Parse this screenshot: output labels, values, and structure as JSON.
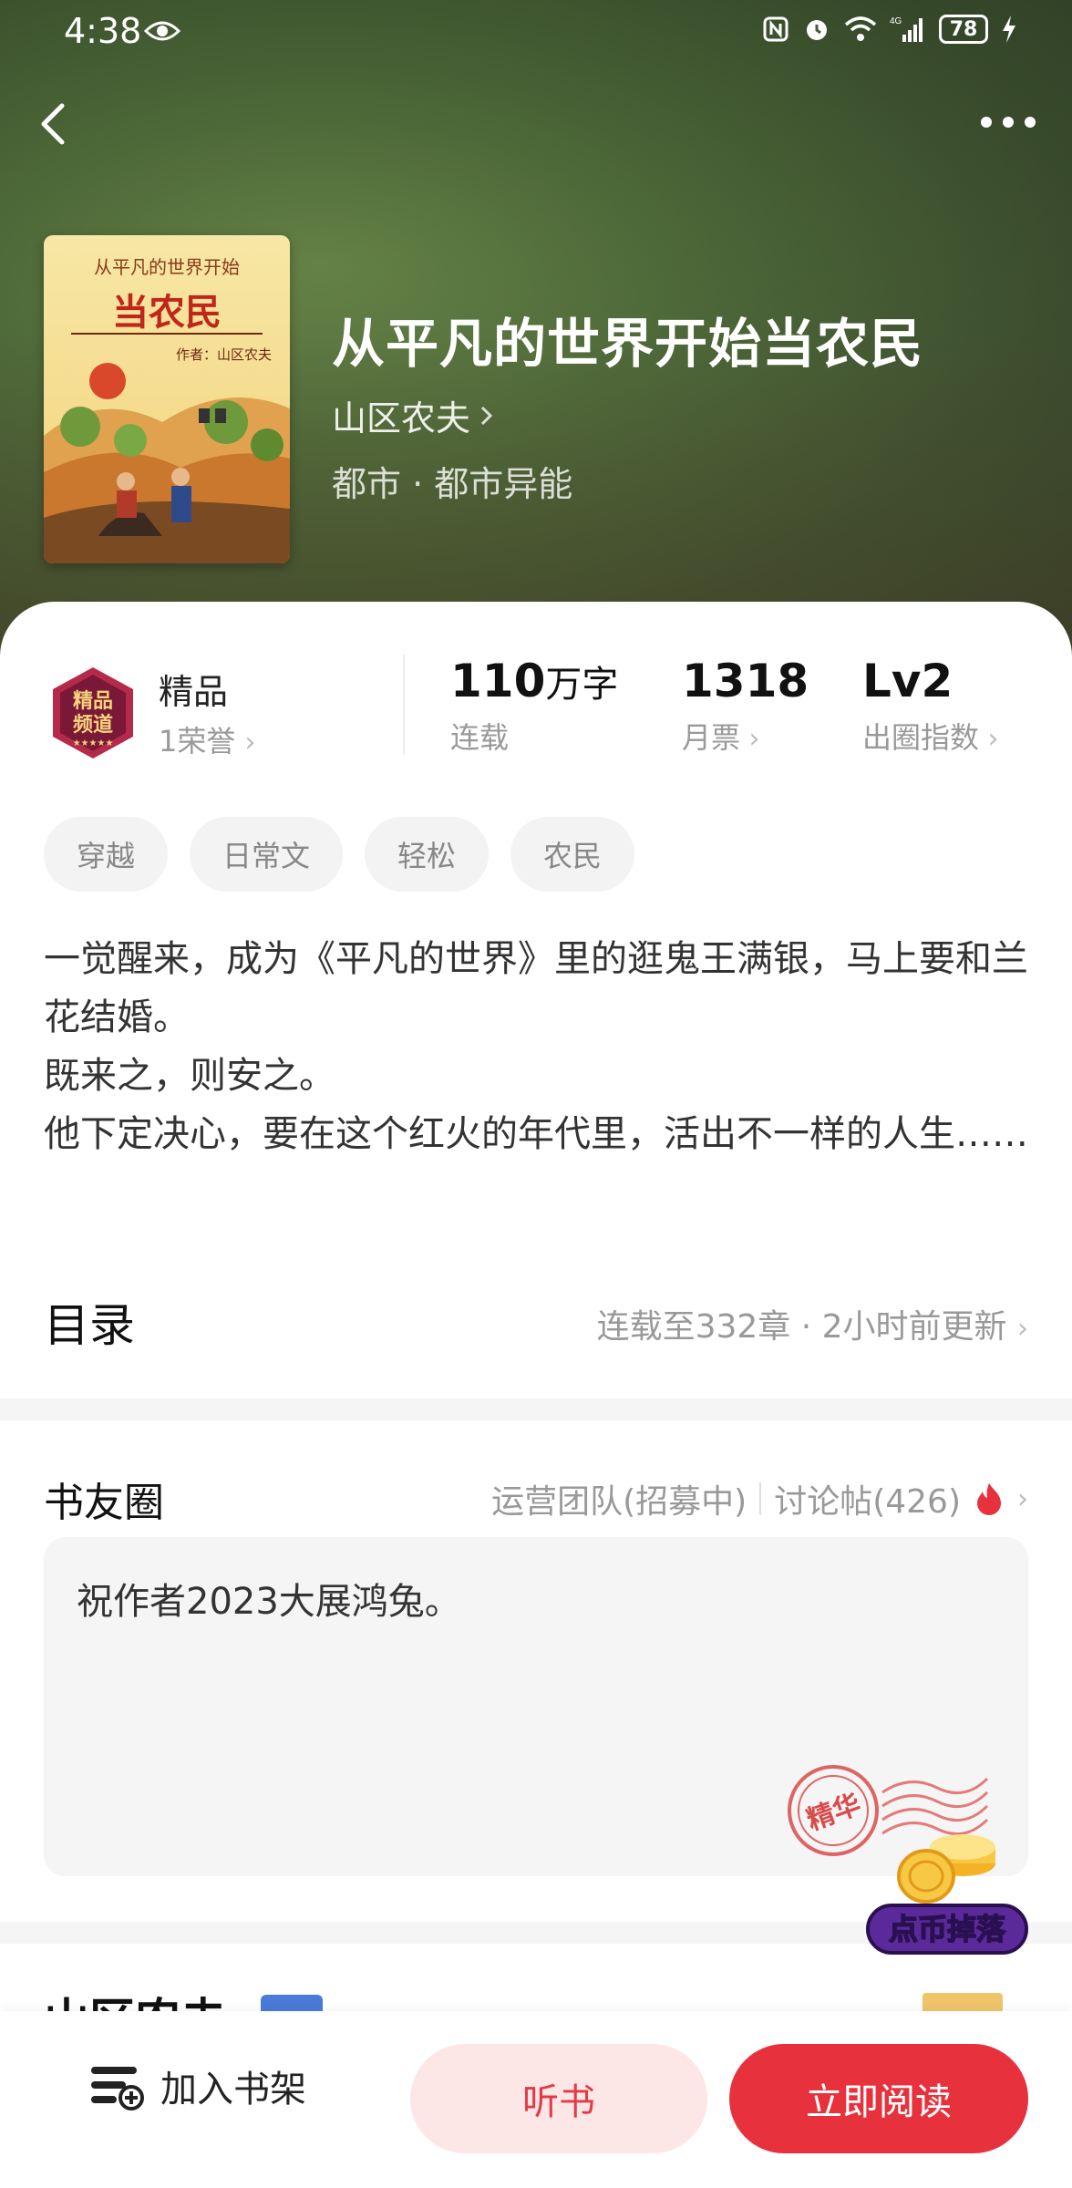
{
  "status_bar": {
    "time": "4:38",
    "battery": "78"
  },
  "book": {
    "title": "从平凡的世界开始当农民",
    "author": "山区农夫",
    "genre": "都市 · 都市异能",
    "cover": {
      "top_text": "从平凡的世界开始",
      "big_text": "当农民",
      "author_text": "作者：山区农夫"
    }
  },
  "stats": {
    "badge": {
      "title": "精品",
      "subtitle": "1荣誉",
      "icon_text_1": "精品",
      "icon_text_2": "频道"
    },
    "words": {
      "value": "110",
      "unit": "万字",
      "label": "连载"
    },
    "tickets": {
      "value": "1318",
      "label": "月票"
    },
    "level": {
      "value": "Lv2",
      "label": "出圈指数"
    }
  },
  "tags": [
    "穿越",
    "日常文",
    "轻松",
    "农民"
  ],
  "description": "一觉醒来，成为《平凡的世界》里的逛鬼王满银，马上要和兰花结婚。\n既来之，则安之。\n他下定决心，要在这个红火的年代里，活出不一样的人生……",
  "toc": {
    "title": "目录",
    "info": "连载至332章 · 2小时前更新"
  },
  "club": {
    "title": "书友圈",
    "team": "运营团队(招募中)",
    "posts": "讨论帖(426)",
    "post_text": "祝作者2023大展鸿兔。",
    "stamp_text": "精华"
  },
  "coin_drop": {
    "label": "点币掉落"
  },
  "author_section": {
    "name": "山区农夫"
  },
  "bottom": {
    "shelf": "加入书架",
    "listen": "听书",
    "read": "立即阅读"
  },
  "colors": {
    "accent": "#e7323d",
    "accent_light": "#fde6e6"
  }
}
